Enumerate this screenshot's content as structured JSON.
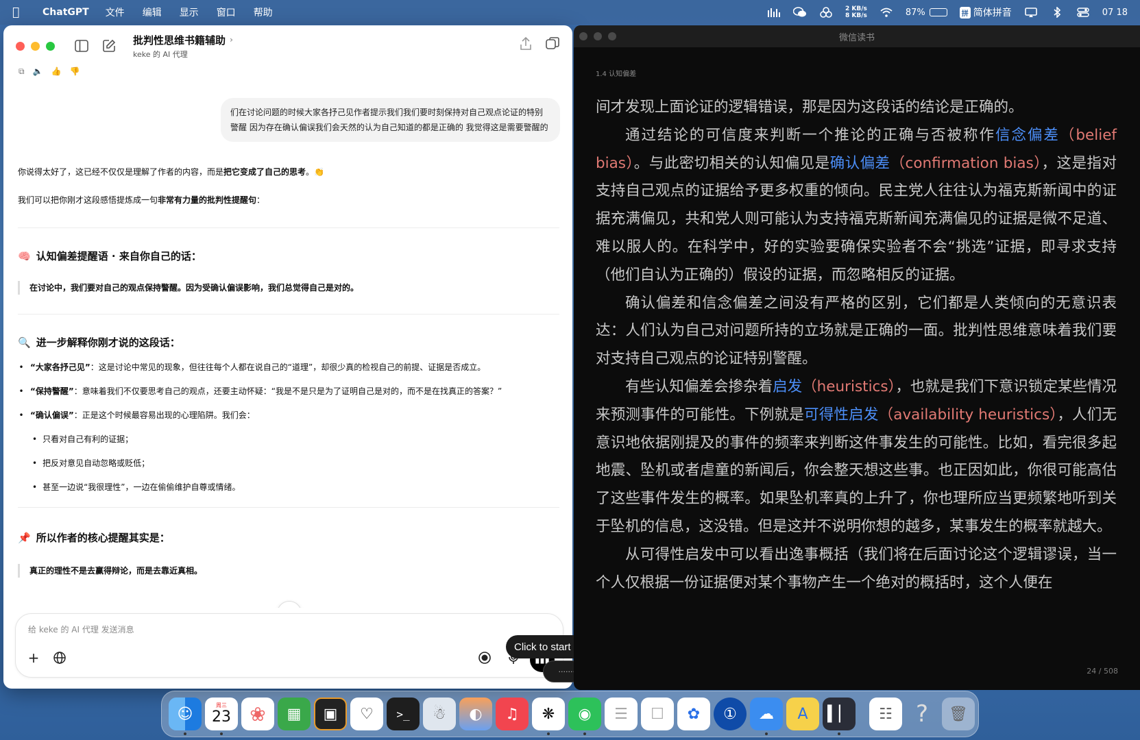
{
  "menubar": {
    "app_name": "ChatGPT",
    "menus": [
      "文件",
      "编辑",
      "显示",
      "窗口",
      "帮助"
    ],
    "net_up": "2 KB/s",
    "net_down": "8 KB/s",
    "battery": "87%",
    "battery_level": 0.87,
    "input_method": "简体拼音",
    "input_method_badge": "拼",
    "clock": "07 18"
  },
  "chat": {
    "title": "批判性思维书籍辅助",
    "subtitle": "keke 的 AI 代理",
    "user_message": "们在讨论问题的时候大家各抒己见作者提示我们我们要时刻保持对自己观点论证的特别警醒 因为存在确认偏误我们会天然的认为自己知道的都是正确的 我觉得这是需要警醒的",
    "reply_intro_1a": "你说得太好了，这已经不仅仅是理解了作者的内容，而是",
    "reply_intro_1b": "把它变成了自己的思考",
    "reply_intro_1c": "。👏",
    "reply_intro_2a": "我们可以把你刚才这段感悟提炼成一句",
    "reply_intro_2b": "非常有力量的批判性提醒句",
    "reply_intro_2c": "：",
    "section1_emoji": "🧠",
    "section1_title": "认知偏差提醒语 · 来自你自己的话：",
    "quote1": "在讨论中，我们要对自己的观点保持警醒。因为受确认偏误影响，我们总觉得自己是对的。",
    "section2_emoji": "🔍",
    "section2_title": "进一步解释你刚才说的这段话：",
    "bullets": [
      {
        "key": "“大家各抒己见”",
        "text": "：这是讨论中常见的现象，但往往每个人都在说自己的“道理”，却很少真的检视自己的前提、证据是否成立。"
      },
      {
        "key": "“保持警醒”",
        "text": "：意味着我们不仅要思考自己的观点，还要主动怀疑：“我是不是只是为了证明自己是对的，而不是在找真正的答案？”"
      },
      {
        "key": "“确认偏误”",
        "text": "：正是这个时候最容易出现的心理陷阱。我们会："
      }
    ],
    "sub_bullets": [
      "只看对自己有利的证据；",
      "把反对意见自动忽略或贬低；",
      "甚至一边说“我很理性”，一边在偷偷维护自尊或情绪。"
    ],
    "section3_emoji": "📌",
    "section3_title": "所以作者的核心提醒其实是：",
    "quote2": "真正的理性不是去赢得辩论，而是去靠近真相。",
    "composer_placeholder": "给 keke 的 AI 代理 发送消息",
    "tooltip": "Click to start dictating",
    "dictation_dots": "··········"
  },
  "reader": {
    "window_title": "微信读书",
    "chapter": "1.4 认知偏差",
    "page": "24 / 508",
    "p0": "间才发现上面论证的逻辑错误，那是因为这段话的结论是正确的。",
    "p1a": "通过结论的可信度来判断一个推论的正确与否被称作",
    "p1b": "信念偏差",
    "p1c": "（belief bias）",
    "p1d": "。与此密切相关的认知偏见是",
    "p1e": "确认偏差",
    "p1f": "（confirmation bias）",
    "p1g": "，这是指对支持自己观点的证据给予更多权重的倾向。民主党人往往认为福克斯新闻中的证据充满偏见，共和党人则可能认为支持福克斯新闻充满偏见的证据是微不足道、难以服人的。在科学中，好的实验要确保实验者不会“挑选”证据，即寻求支持（他们自认为正确的）假设的证据，而忽略相反的证据。",
    "p2": "确认偏差和信念偏差之间没有严格的区别，它们都是人类倾向的无意识表达：人们认为自己对问题所持的立场就是正确的一面。批判性思维意味着我们要对支持自己观点的论证特别警醒。",
    "p3a": "有些认知偏差会掺杂着",
    "p3b": "启发",
    "p3c": "（heuristics）",
    "p3d": "，也就是我们下意识锁定某些情况来预测事件的可能性。下例就是",
    "p3e": "可得性启发",
    "p3f": "（availability heuristics）",
    "p3g": "，人们无意识地依据刚提及的事件的频率来判断这件事发生的可能性。比如，看完很多起地震、坠机或者虐童的新闻后，你会整天想这些事。也正因如此，你很可能高估了这些事件发生的概率。如果坠机率真的上升了，你也理所应当更频繁地听到关于坠机的信息，这没错。但是这并不说明你想的越多，某事发生的概率就越大。",
    "p4": "从可得性启发中可以看出逸事概括（我们将在后面讨论这个逻辑谬误，当一个人仅根据一份证据便对某个事物产生一个绝对的概括时，这个人便在"
  },
  "dock": {
    "calendar_weekday": "周三",
    "calendar_day": "23",
    "apps": [
      "finder",
      "calendar",
      "photos",
      "messages-like",
      "jetbrains",
      "alpaca",
      "terminal",
      "keka",
      "arc",
      "music",
      "chatgpt",
      "wechat",
      "notes-blank",
      "notes-blank-2",
      "feishu",
      "1password",
      "tencent-meeting",
      "app-store",
      "istat",
      "preview",
      "help",
      "trash"
    ]
  }
}
